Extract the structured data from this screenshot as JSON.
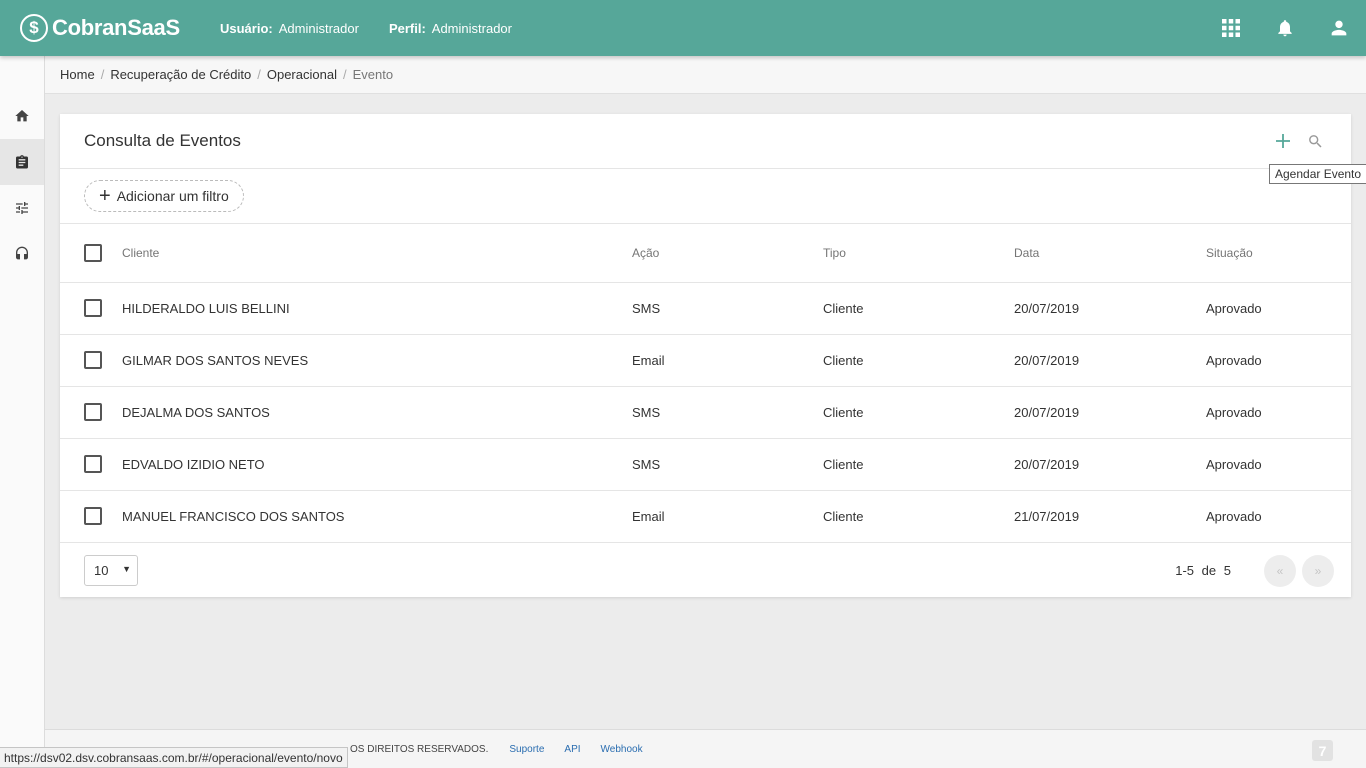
{
  "header": {
    "logo_mark": "$",
    "logo_text": "CobranSaaS",
    "user_label": "Usuário:",
    "user_value": "Administrador",
    "profile_label": "Perfil:",
    "profile_value": "Administrador",
    "icons": [
      "apps-grid-icon",
      "bell-icon",
      "user-icon"
    ],
    "brand_color": "#56a799"
  },
  "sidebar": {
    "items": [
      {
        "icon": "home-icon",
        "active": false
      },
      {
        "icon": "clipboard-icon",
        "active": true
      },
      {
        "icon": "sliders-icon",
        "active": false
      },
      {
        "icon": "headset-icon",
        "active": false
      }
    ]
  },
  "breadcrumb": {
    "items": [
      "Home",
      "Recuperação de Crédito",
      "Operacional",
      "Evento"
    ]
  },
  "card": {
    "title": "Consulta de Eventos",
    "add_icon": "plus-icon",
    "search_icon": "search-icon",
    "add_tooltip": "Agendar Evento",
    "filter_button": "Adicionar um filtro"
  },
  "table": {
    "headers": [
      "Cliente",
      "Ação",
      "Tipo",
      "Data",
      "Situação"
    ],
    "rows": [
      [
        "HILDERALDO LUIS BELLINI",
        "SMS",
        "Cliente",
        "20/07/2019",
        "Aprovado"
      ],
      [
        "GILMAR DOS SANTOS NEVES",
        "Email",
        "Cliente",
        "20/07/2019",
        "Aprovado"
      ],
      [
        "DEJALMA DOS SANTOS",
        "SMS",
        "Cliente",
        "20/07/2019",
        "Aprovado"
      ],
      [
        "EDVALDO IZIDIO NETO",
        "SMS",
        "Cliente",
        "20/07/2019",
        "Aprovado"
      ],
      [
        "MANUEL FRANCISCO DOS SANTOS",
        "Email",
        "Cliente",
        "21/07/2019",
        "Aprovado"
      ]
    ]
  },
  "pagination": {
    "page_size": "10",
    "range": "1-5",
    "of_label": "de",
    "total": "5",
    "prev_label": "«",
    "next_label": "»"
  },
  "footer": {
    "rights": "OS DIREITOS RESERVADOS.",
    "links": [
      "Suporte",
      "API",
      "Webhook"
    ],
    "logo_mark": "7"
  },
  "status_bar": {
    "url": "https://dsv02.dsv.cobransaas.com.br/#/operacional/evento/novo"
  }
}
